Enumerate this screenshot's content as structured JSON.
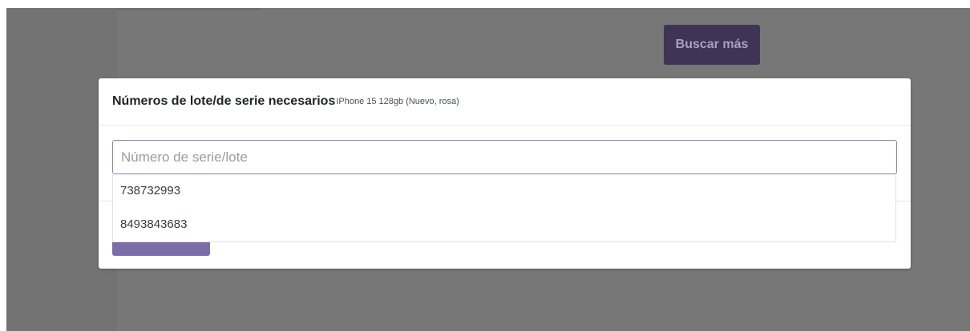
{
  "background": {
    "buscar_label": "Buscar más"
  },
  "modal": {
    "title": "Números de lote/de serie necesarios",
    "subtitle": "IPhone 15 128gb (Nuevo, rosa)",
    "input": {
      "placeholder": "Número de serie/lote",
      "value": ""
    },
    "suggestions": [
      {
        "label": "738732993"
      },
      {
        "label": "8493843683"
      }
    ],
    "confirm_label": ""
  },
  "colors": {
    "accent": "#7a6ea8",
    "accent_dark": "#3f3455",
    "overlay": "#777778"
  }
}
